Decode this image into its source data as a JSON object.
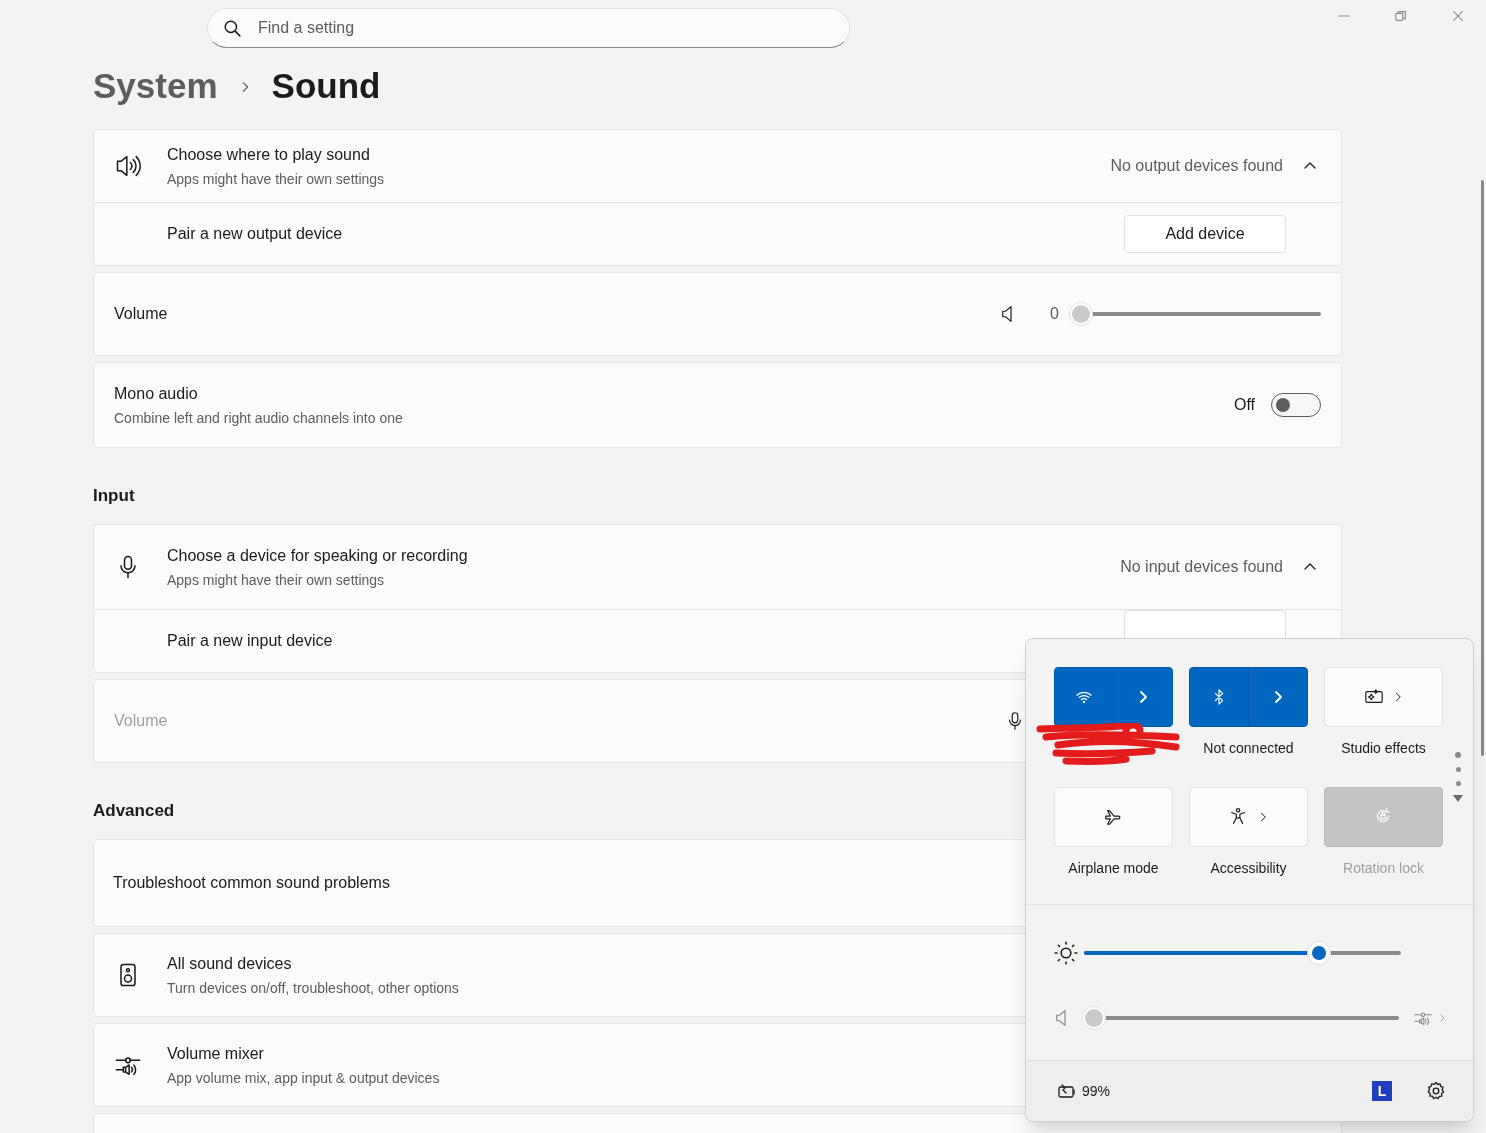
{
  "search": {
    "placeholder": "Find a setting"
  },
  "breadcrumb": [
    {
      "label": "System",
      "current": false
    },
    {
      "label": "Sound",
      "current": true
    }
  ],
  "output": {
    "title": "Choose where to play sound",
    "subtitle": "Apps might have their own settings",
    "status": "No output devices found",
    "expanded": true,
    "pair_label": "Pair a new output device",
    "button": "Add device"
  },
  "output_volume": {
    "label": "Volume",
    "reading": "0",
    "level": 0
  },
  "mono_audio": {
    "title": "Mono audio",
    "subtitle": "Combine left and right audio channels into one",
    "state_label": "Off",
    "on": false
  },
  "input_heading": "Input",
  "input": {
    "title": "Choose a device for speaking or recording",
    "subtitle": "Apps might have their own settings",
    "status": "No input devices found",
    "expanded": true,
    "pair_label": "Pair a new input device"
  },
  "input_volume": {
    "label": "Volume",
    "disabled": true
  },
  "advanced_heading": "Advanced",
  "advanced_items": [
    {
      "kind": "plain",
      "title": "Troubleshoot common sound problems"
    },
    {
      "kind": "speaker",
      "title": "All sound devices",
      "subtitle": "Turn devices on/off, troubleshoot, other options"
    },
    {
      "kind": "mixer",
      "title": "Volume mixer",
      "subtitle": "App volume mix, app input & output devices"
    },
    {
      "kind": "empty"
    }
  ],
  "quick_settings": {
    "tiles": [
      {
        "kind": "wifi",
        "on": true,
        "disabled": false
      },
      {
        "kind": "bluetooth",
        "on": true,
        "disabled": false,
        "label": "Not connected"
      },
      {
        "kind": "studio",
        "on": false,
        "disabled": false,
        "label": "Studio effects"
      },
      {
        "kind": "airplane",
        "on": false,
        "disabled": false,
        "label": "Airplane mode"
      },
      {
        "kind": "accessibility",
        "on": false,
        "disabled": false,
        "label": "Accessibility"
      },
      {
        "kind": "rotation",
        "disabled": true,
        "label": "Rotation lock"
      }
    ],
    "brightness": {
      "level": 0.76
    },
    "volume": {
      "level": 0
    },
    "battery": "99%",
    "user_initial": "L"
  }
}
